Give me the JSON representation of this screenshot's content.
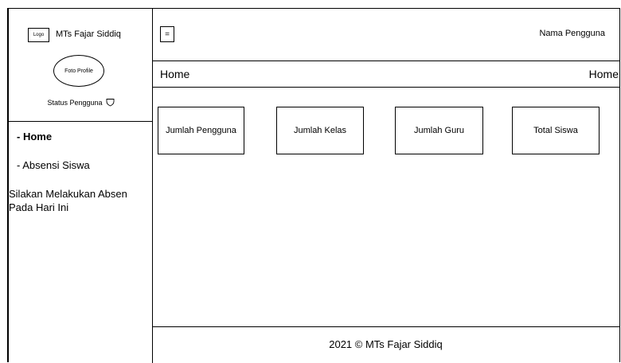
{
  "brand": {
    "logo_label": "Logo",
    "name": "MTs Fajar Siddiq"
  },
  "profile": {
    "photo_label": "Foto Profile",
    "status_label": "Status Pengguna",
    "status_icon": "shield-icon"
  },
  "sidebar": {
    "items": [
      {
        "label": "- Home"
      },
      {
        "label": "- Absensi Siswa"
      }
    ],
    "note": "Silakan Melakukan Absen Pada Hari Ini"
  },
  "topbar": {
    "menu_label": "=",
    "user_name": "Nama Pengguna"
  },
  "header": {
    "title": "Home",
    "breadcrumb": "Home"
  },
  "cards": [
    {
      "label": "Jumlah Pengguna"
    },
    {
      "label": "Jumlah Kelas"
    },
    {
      "label": "Jumlah Guru"
    },
    {
      "label": "Total Siswa"
    }
  ],
  "footer": {
    "text": "2021 © MTs Fajar Siddiq"
  }
}
